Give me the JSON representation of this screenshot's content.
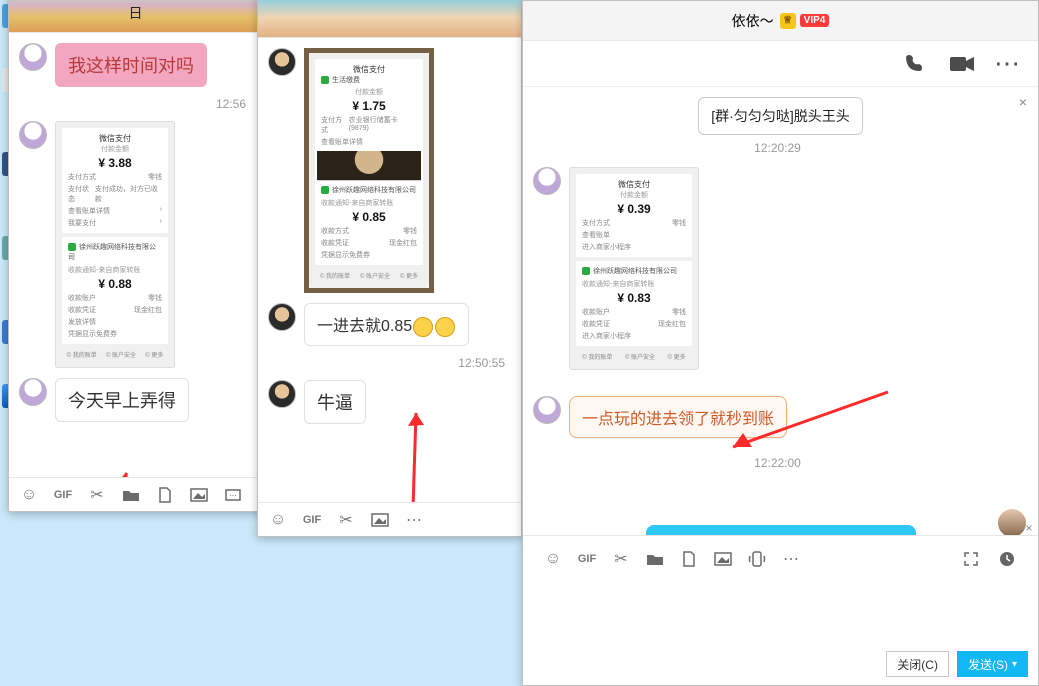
{
  "window_title": "依依～",
  "vip_level": "VIP4",
  "timestamps": {
    "t1": "12:56",
    "t2": "12:50:55",
    "t3_top": "12:20:29",
    "t3_bottom": "12:22:00"
  },
  "back2": {
    "bg_title_frag": "日",
    "pink_msg": "我这样时间对吗",
    "pay1": {
      "header": "微信支付",
      "label_top": "付款金额",
      "amount_top": "¥ 3.88",
      "r1k": "支付方式",
      "r1v": "零钱",
      "r2k": "支付状态",
      "r2v": "支付成功，对方已收款",
      "r3k": "查看账单详情",
      "r4k": "我要支付",
      "company": "徐州跃趣网络科技有限公司",
      "label_mid": "收款通知-来自商家转账",
      "amount_mid": "¥ 0.88",
      "rk5": "收款账户",
      "rv5": "零钱",
      "rk6": "收款凭证",
      "rv6": "现金红包",
      "rk7": "发放详情",
      "rk8": "凭据显示免费券",
      "foot1": "© 我的账单",
      "foot2": "© 账户安全",
      "foot3": "© 更多"
    },
    "white_msg": "今天早上弄得"
  },
  "back1": {
    "framed_pay": {
      "header": "微信支付",
      "biz1": "生活缴费",
      "label1": "付款金额",
      "amount1": "¥ 1.75",
      "r1k": "支付方式",
      "r1v": "农业银行储蓄卡(9879)",
      "r2k": "查看账单详情",
      "company": "徐州跃趣网络科技有限公司",
      "label2": "收款通知-来自商家转账",
      "amount2": "¥ 0.85",
      "rk3": "收款方式",
      "rv3": "零钱",
      "rk4": "收款凭证",
      "rv4": "现金红包",
      "rk5": "凭据显示免费券",
      "foot1": "© 我的账单",
      "foot2": "© 账户安全",
      "foot3": "© 更多"
    },
    "msg_085": "一进去就0.85",
    "msg_nb": "牛逼"
  },
  "front": {
    "clipped_top": "[群·匀匀匀哒]脱头王头",
    "pay": {
      "header": "微信支付",
      "label_top": "付款金额",
      "amount_top": "¥ 0.39",
      "r1k": "支付方式",
      "r1v": "零钱",
      "r2k": "查看账单",
      "r3k": "进入商家小程序",
      "company": "徐州跃趣网络科技有限公司",
      "label_mid": "收款通知-来自商家转账",
      "amount_mid": "¥ 0.83",
      "rk5": "收款账户",
      "rv5": "零钱",
      "rk6": "收款凭证",
      "rv6": "现金红包",
      "rk7": "进入商家小程序",
      "foot1": "© 我的账单",
      "foot2": "© 账户安全",
      "foot3": "© 更多"
    },
    "fancy_msg": "一点玩的进去领了就秒到账"
  },
  "buttons": {
    "close": "关闭(C)",
    "send": "发送(S)"
  }
}
